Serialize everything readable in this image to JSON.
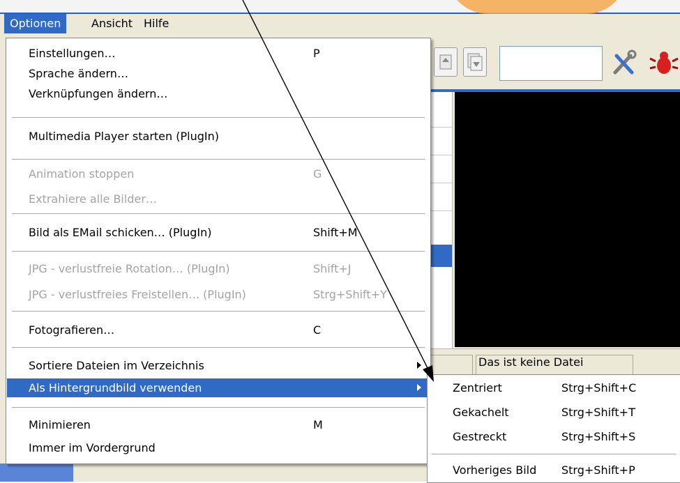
{
  "menubar": {
    "items": [
      "Optionen",
      "Ansicht",
      "Hilfe"
    ]
  },
  "main_menu": {
    "items": [
      {
        "label": "Einstellungen…",
        "shortcut": "P"
      },
      {
        "label": "Sprache ändern…",
        "shortcut": ""
      },
      {
        "label": "Verknüpfungen ändern…",
        "shortcut": ""
      },
      {
        "label": "Multimedia Player starten (PlugIn)",
        "shortcut": ""
      },
      {
        "label": "Animation stoppen",
        "shortcut": "G"
      },
      {
        "label": "Extrahiere alle Bilder…",
        "shortcut": ""
      },
      {
        "label": "Bild als EMail schicken… (PlugIn)",
        "shortcut": "Shift+M"
      },
      {
        "label": "JPG - verlustfreie Rotation… (PlugIn)",
        "shortcut": "Shift+J"
      },
      {
        "label": "JPG - verlustfreies Freistellen… (PlugIn)",
        "shortcut": "Strg+Shift+Y"
      },
      {
        "label": "Fotografieren…",
        "shortcut": "C"
      },
      {
        "label": "Sortiere Dateien im Verzeichnis",
        "shortcut": ""
      },
      {
        "label": "Als Hintergrundbild verwenden",
        "shortcut": ""
      },
      {
        "label": "Minimieren",
        "shortcut": "M"
      },
      {
        "label": "Immer im Vordergrund",
        "shortcut": ""
      }
    ]
  },
  "sub_menu": {
    "items": [
      {
        "label": "Zentriert",
        "shortcut": "Strg+Shift+C"
      },
      {
        "label": "Gekachelt",
        "shortcut": "Strg+Shift+T"
      },
      {
        "label": "Gestreckt",
        "shortcut": "Strg+Shift+S"
      },
      {
        "label": "Vorheriges Bild",
        "shortcut": "Strg+Shift+P"
      }
    ]
  },
  "status": {
    "text": "Das ist keine Datei"
  },
  "icons": {
    "toolbar": [
      "page-up-icon",
      "page-down-icon",
      "tools-icon",
      "bug-icon"
    ],
    "submenu_arrow": "triangle-right-icon"
  },
  "colors": {
    "highlight": "#316ac5",
    "menu_background": "#ffffff",
    "disabled_text": "#a3a3a3",
    "annotation_orange": "#f5a84b"
  }
}
